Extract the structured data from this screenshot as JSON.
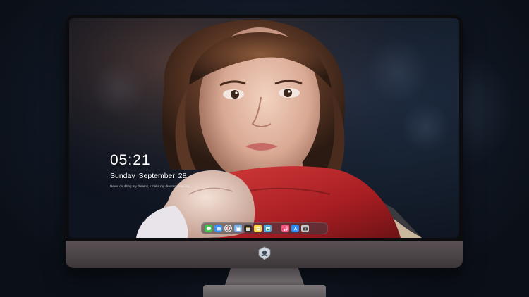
{
  "lockscreen": {
    "time": "05:21",
    "date": "Sunday September  28",
    "quote": "Never doubting my dreams, I make my dreams come tru..."
  },
  "dock": {
    "items": [
      {
        "name": "messages",
        "icon": "message-icon",
        "color": "#3fc24f"
      },
      {
        "name": "finder",
        "icon": "folder-icon",
        "color": "#3b8ff0"
      },
      {
        "name": "safari",
        "icon": "compass-icon",
        "color": "#e6e6e6"
      },
      {
        "name": "files",
        "icon": "files-icon",
        "color": "#7bb0e8"
      },
      {
        "name": "video",
        "icon": "clapper-icon",
        "color": "#2d2d2d"
      },
      {
        "name": "notes",
        "icon": "notes-icon",
        "color": "#f7d64a"
      },
      {
        "name": "preview",
        "icon": "image-icon",
        "color": "#4ea6d8"
      },
      {
        "name": "music",
        "icon": "music-icon",
        "color": "#f2557f"
      },
      {
        "name": "app-store",
        "icon": "app-store-icon",
        "color": "#2a8cf7"
      },
      {
        "name": "camera",
        "icon": "camera-icon",
        "color": "#c9c9c9"
      }
    ]
  },
  "colors": {
    "accent": "#3b8ff0",
    "chin": "#4a4346",
    "scarf": "#b8262a"
  }
}
